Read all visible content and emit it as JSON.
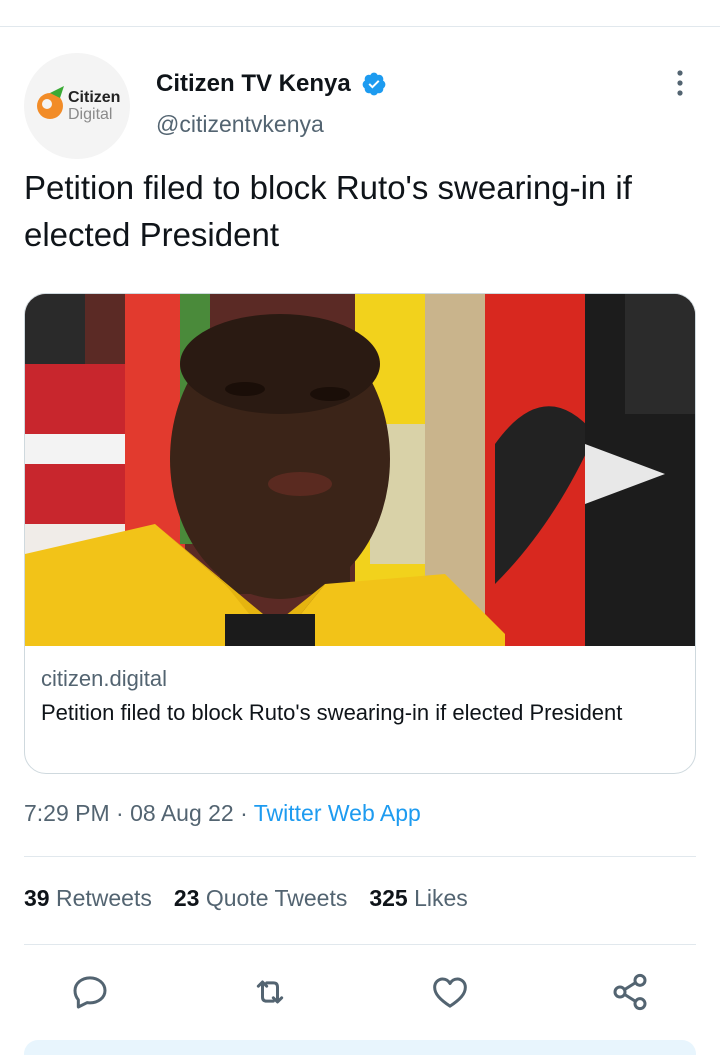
{
  "account": {
    "display_name": "Citizen TV Kenya",
    "handle": "@citizentvkenya",
    "avatar_line1": "Citizen",
    "avatar_line2": "Digital",
    "verified": true
  },
  "tweet": {
    "text": "Petition filed to block Ruto's swearing-in if elected President"
  },
  "card": {
    "domain": "citizen.digital",
    "title": "Petition filed to block Ruto's swearing-in if elected President"
  },
  "meta": {
    "time": "7:29 PM",
    "sep1": " · ",
    "date": "08 Aug 22",
    "sep2": " · ",
    "app": "Twitter Web App"
  },
  "stats": {
    "retweets_count": "39",
    "retweets_label": "Retweets",
    "quotes_count": "23",
    "quotes_label": "Quote Tweets",
    "likes_count": "325",
    "likes_label": "Likes"
  },
  "colors": {
    "accent": "#1d9bf0",
    "secondary_text": "#536471",
    "divider": "#e1e8ed",
    "brand_orange": "#f28c28",
    "brand_green": "#3aaa35"
  },
  "icons": [
    "verified-icon",
    "more-icon",
    "reply-icon",
    "retweet-icon",
    "like-icon",
    "share-icon"
  ]
}
